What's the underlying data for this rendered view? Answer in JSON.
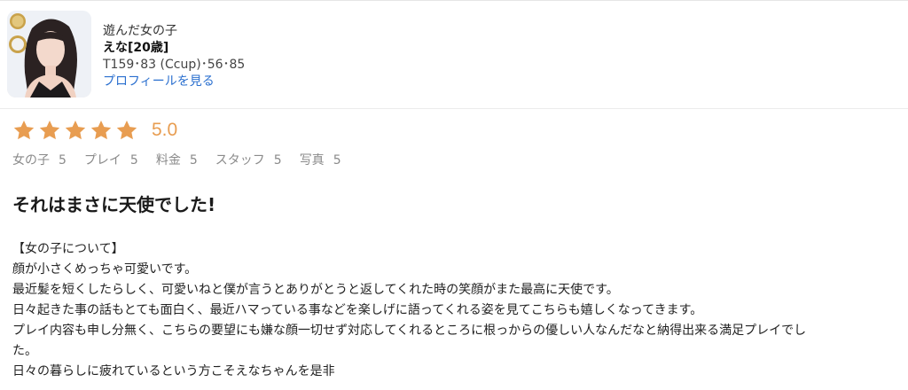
{
  "profile": {
    "label": "遊んだ女の子",
    "name": "えな[20歳]",
    "stats": "T159･83 (Ccup)･56･85",
    "link": "プロフィールを見る"
  },
  "rating": {
    "score": "5.0",
    "stars": 5,
    "star_color": "#e89d51",
    "subscores": [
      {
        "label": "女の子",
        "value": "5"
      },
      {
        "label": "プレイ",
        "value": "5"
      },
      {
        "label": "料金",
        "value": "5"
      },
      {
        "label": "スタッフ",
        "value": "5"
      },
      {
        "label": "写真",
        "value": "5"
      }
    ]
  },
  "review": {
    "title": "それはまさに天使でした!",
    "lines": [
      "【女の子について】",
      "顔が小さくめっちゃ可愛いです。",
      "最近髪を短くしたらしく、可愛いねと僕が言うとありがとうと返してくれた時の笑顔がまた最高に天使です。",
      "日々起きた事の話もとても面白く、最近ハマっている事などを楽しげに語ってくれる姿を見てこちらも嬉しくなってきます。",
      "プレイ内容も申し分無く、こちらの要望にも嫌な顔一切せず対応してくれるところに根っからの優しい人なんだなと納得出来る満足プレイでし",
      "た。",
      "日々の暮らしに疲れているという方こそえなちゃんを是非"
    ]
  }
}
